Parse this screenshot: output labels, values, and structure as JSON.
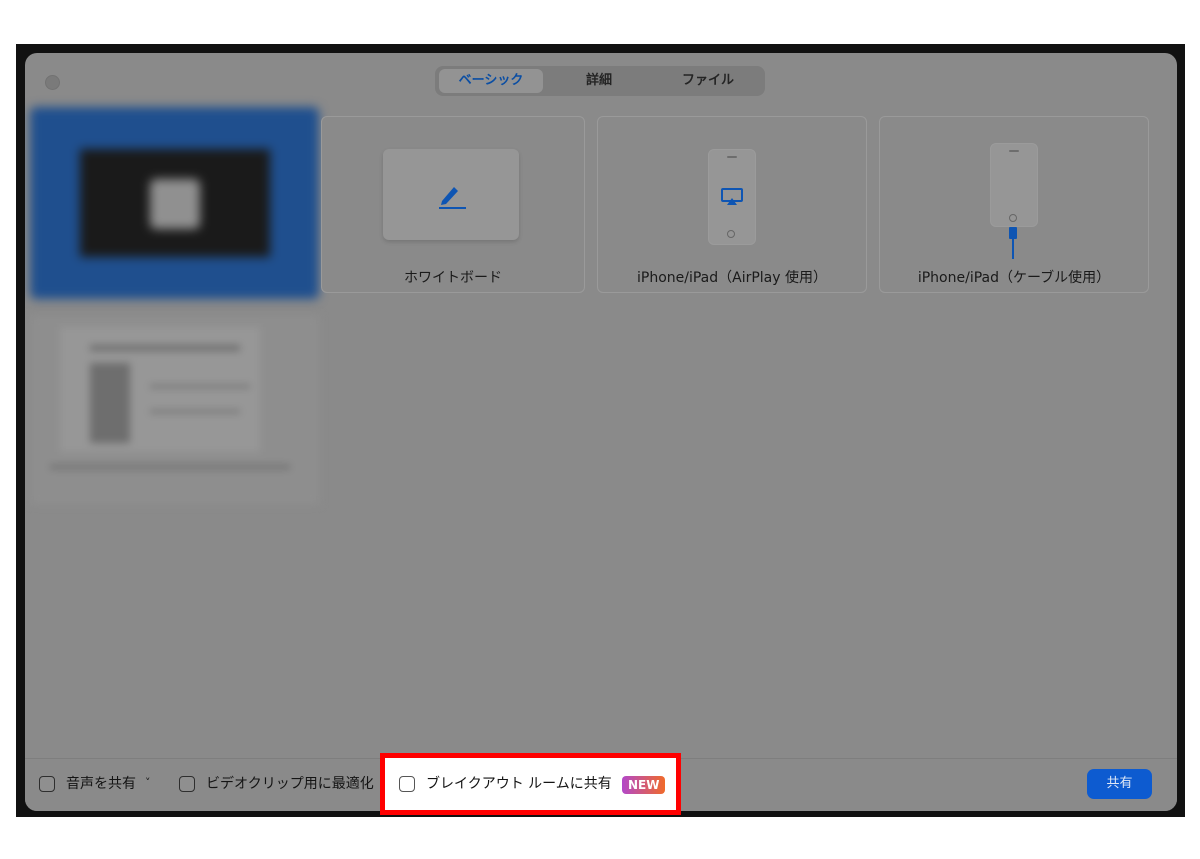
{
  "tabs": [
    {
      "label": "ベーシック",
      "active": true
    },
    {
      "label": "詳細",
      "active": false
    },
    {
      "label": "ファイル",
      "active": false
    }
  ],
  "tiles": [
    {
      "label": "ホワイトボード",
      "icon": "pen-icon"
    },
    {
      "label": "iPhone/iPad（AirPlay 使用）",
      "icon": "airplay-icon"
    },
    {
      "label": "iPhone/iPad（ケーブル使用）",
      "icon": "cable-icon"
    }
  ],
  "bottom": {
    "share_audio": "音声を共有",
    "share_audio_chevron": "˅",
    "optimize_video": "ビデオクリップ用に最適化",
    "share_breakout": "ブレイクアウト ルームに共有",
    "new_badge": "NEW",
    "share_button": "共有"
  },
  "colors": {
    "accent": "#0d5bd0",
    "highlight_border": "#ff0000",
    "overlay_gray": "#8a8a8a"
  }
}
